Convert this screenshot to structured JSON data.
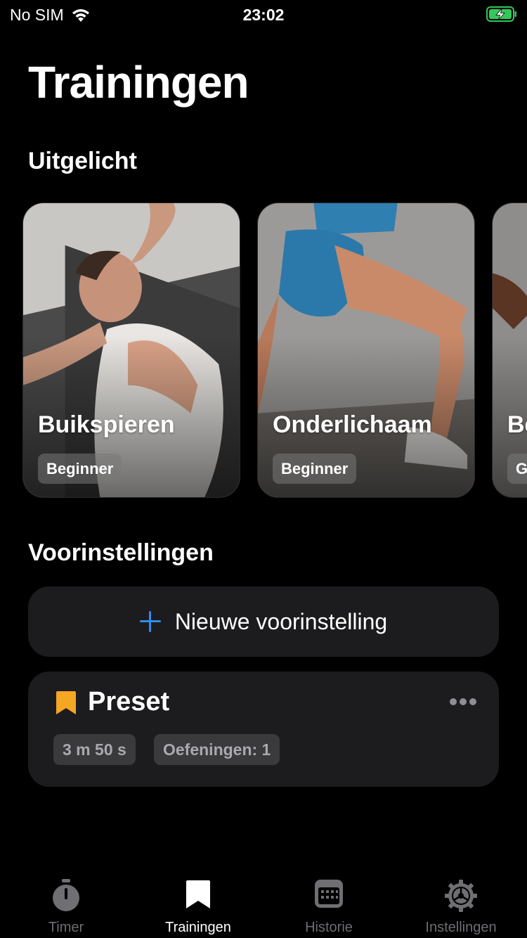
{
  "status_bar": {
    "carrier": "No SIM",
    "time": "23:02"
  },
  "page_title": "Trainingen",
  "featured": {
    "title": "Uitgelicht",
    "cards": [
      {
        "title": "Buikspieren",
        "level": "Beginner"
      },
      {
        "title": "Onderlichaam",
        "level": "Beginner"
      },
      {
        "title": "Be",
        "level": "G"
      }
    ]
  },
  "presets": {
    "title": "Voorinstellingen",
    "new_label": "Nieuwe voorinstelling",
    "items": [
      {
        "name": "Preset",
        "duration": "3 m 50 s",
        "exercises": "Oefeningen: 1"
      }
    ]
  },
  "tabs": [
    {
      "label": "Timer",
      "icon": "stopwatch-icon",
      "active": false
    },
    {
      "label": "Trainingen",
      "icon": "bookmark-icon",
      "active": true
    },
    {
      "label": "Historie",
      "icon": "calendar-icon",
      "active": false
    },
    {
      "label": "Instellingen",
      "icon": "gear-icon",
      "active": false
    }
  ],
  "colors": {
    "accent_blue": "#2f8cf0",
    "bookmark_orange": "#f5a623",
    "battery_green": "#34c759",
    "card_bg": "#1c1c1e"
  }
}
